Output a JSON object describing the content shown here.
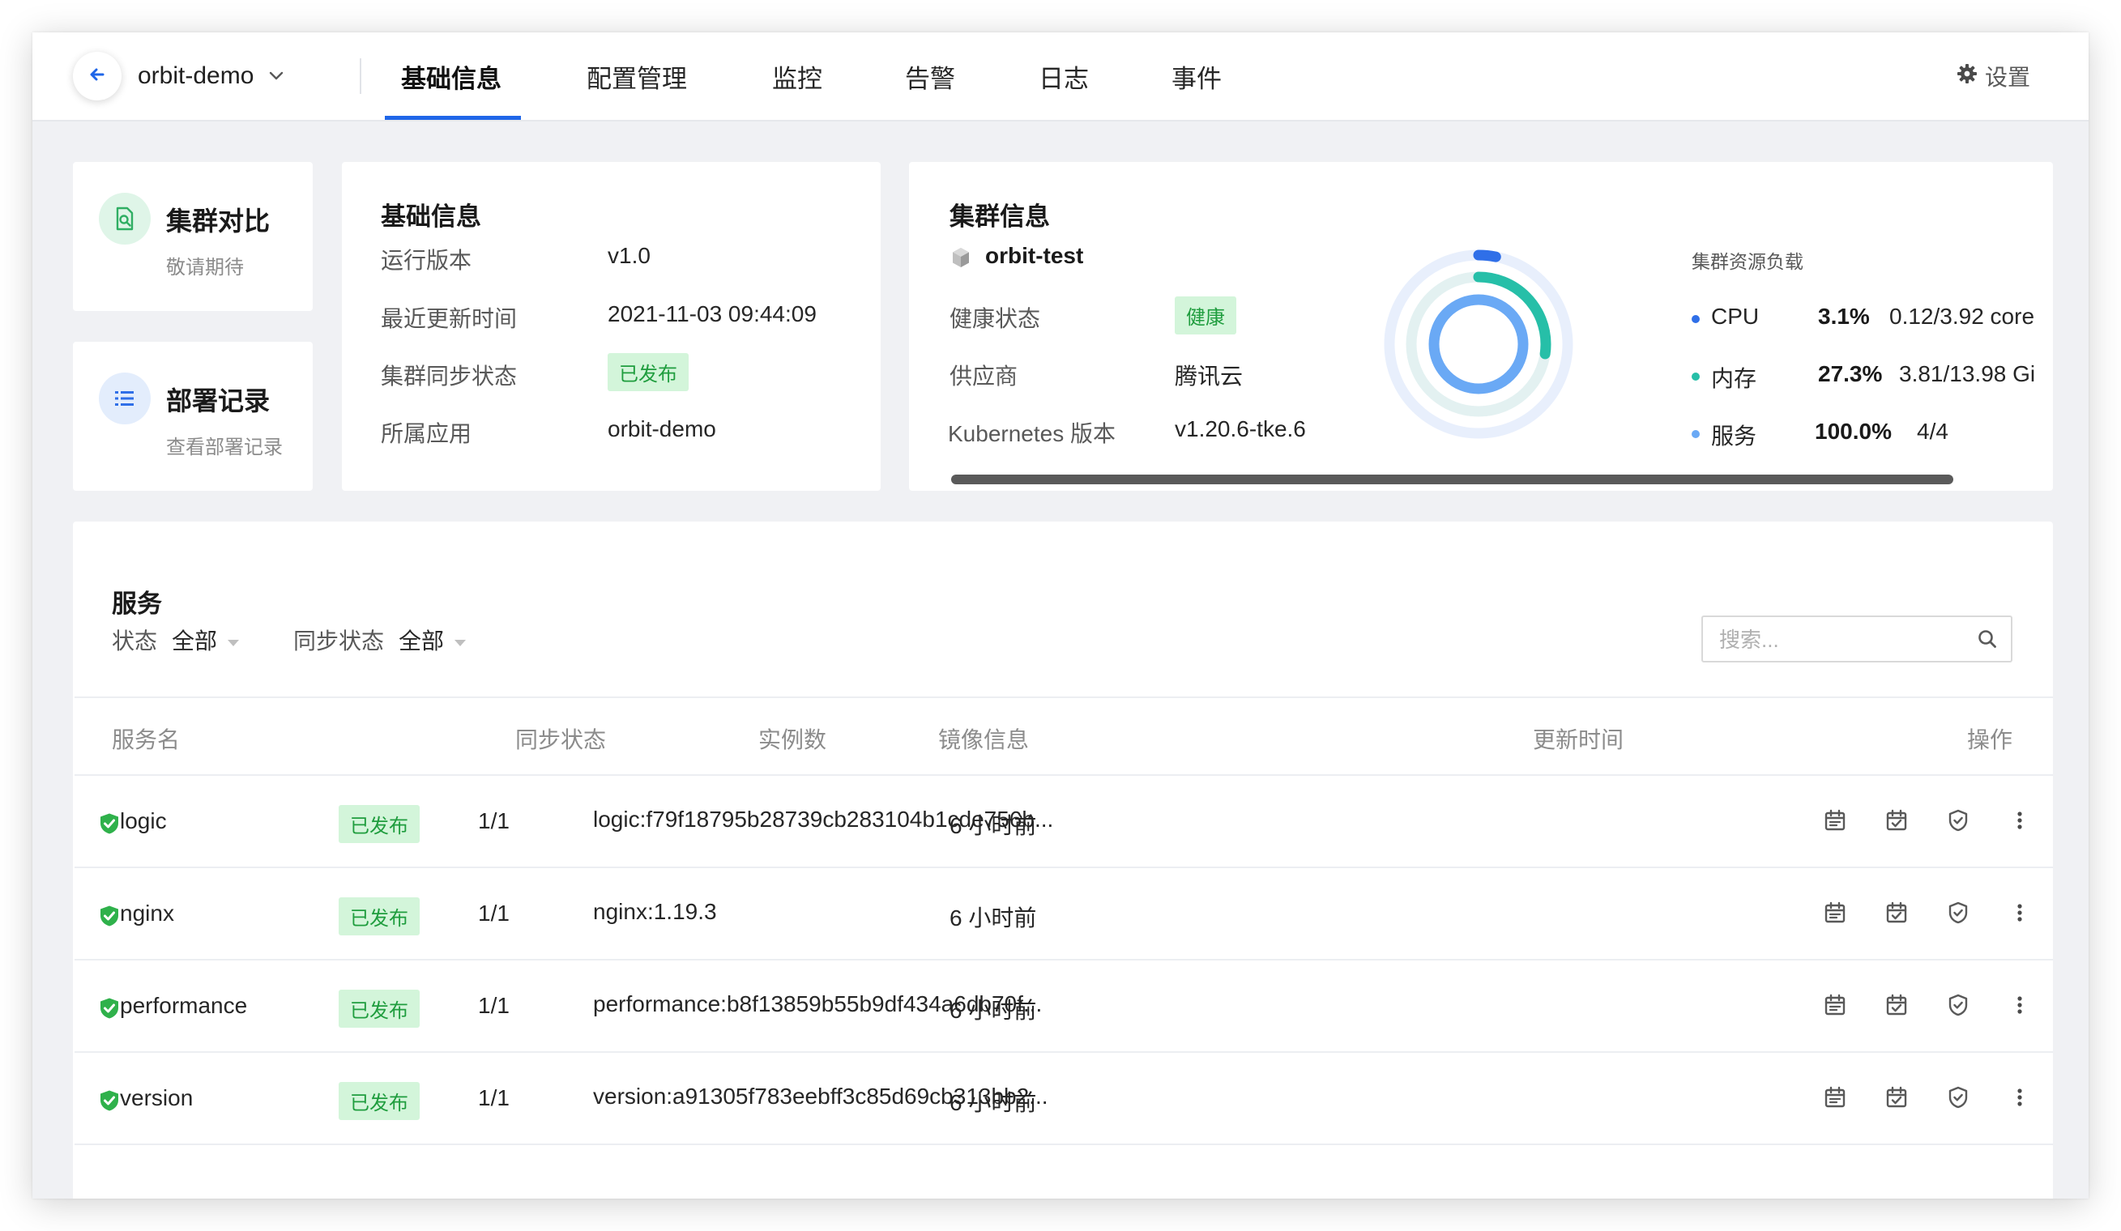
{
  "header": {
    "app_name": "orbit-demo",
    "tabs": [
      {
        "label": "基础信息",
        "active": true
      },
      {
        "label": "配置管理",
        "active": false
      },
      {
        "label": "监控",
        "active": false
      },
      {
        "label": "告警",
        "active": false
      },
      {
        "label": "日志",
        "active": false
      },
      {
        "label": "事件",
        "active": false
      }
    ],
    "settings_label": "设置"
  },
  "side_cards": {
    "compare": {
      "title": "集群对比",
      "subtitle": "敬请期待",
      "icon": "compare-doc-icon"
    },
    "deploy": {
      "title": "部署记录",
      "subtitle": "查看部署记录",
      "icon": "list-icon"
    }
  },
  "basic_info": {
    "title": "基础信息",
    "rows": [
      {
        "label": "运行版本",
        "value": "v1.0"
      },
      {
        "label": "最近更新时间",
        "value": "2021-11-03 09:44:09"
      },
      {
        "label": "集群同步状态",
        "value": "已发布"
      },
      {
        "label": "所属应用",
        "value": "orbit-demo"
      }
    ]
  },
  "cluster_info": {
    "title": "集群信息",
    "cluster_name": "orbit-test",
    "rows": [
      {
        "label": "健康状态",
        "value": "健康"
      },
      {
        "label": "供应商",
        "value": "腾讯云"
      },
      {
        "label": "Kubernetes 版本",
        "value": "v1.20.6-tke.6"
      }
    ],
    "load_title": "集群资源负载",
    "load": [
      {
        "name": "CPU",
        "percent": "3.1%",
        "value": "0.12/3.92 core",
        "fraction": 0.031,
        "color": "#2f6fe8"
      },
      {
        "name": "内存",
        "percent": "27.3%",
        "value": "3.81/13.98 Gi",
        "fraction": 0.273,
        "color": "#26bfa8"
      },
      {
        "name": "服务",
        "percent": "100.0%",
        "value": "4/4",
        "fraction": 1.0,
        "color": "#6aa9f5"
      }
    ]
  },
  "services": {
    "title": "服务",
    "filters": [
      {
        "label": "状态",
        "value": "全部"
      },
      {
        "label": "同步状态",
        "value": "全部"
      }
    ],
    "search_placeholder": "搜索...",
    "columns": [
      "服务名",
      "同步状态",
      "实例数",
      "镜像信息",
      "更新时间",
      "操作"
    ],
    "rows": [
      {
        "name": "logic",
        "sync": "已发布",
        "instances": "1/1",
        "image": "logic:f79f18795b28739cb283104b1cde756b...",
        "updated": "6 小时前"
      },
      {
        "name": "nginx",
        "sync": "已发布",
        "instances": "1/1",
        "image": "nginx:1.19.3",
        "updated": "6 小时前"
      },
      {
        "name": "performance",
        "sync": "已发布",
        "instances": "1/1",
        "image": "performance:b8f13859b55b9df434a6db70f...",
        "updated": "6 小时前"
      },
      {
        "name": "version",
        "sync": "已发布",
        "instances": "1/1",
        "image": "version:a91305f783eebff3c85d69cb313bb2...",
        "updated": "6 小时前"
      }
    ]
  }
}
